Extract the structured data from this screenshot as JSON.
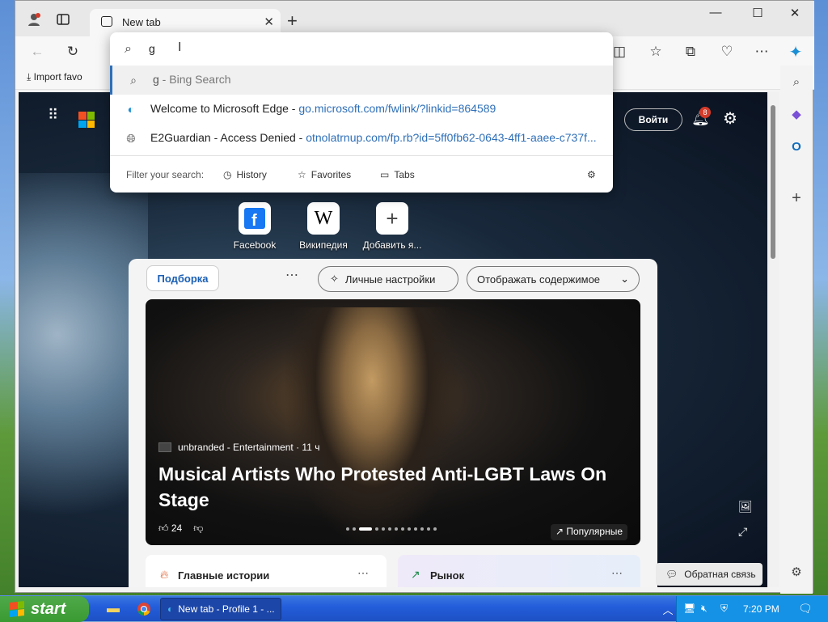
{
  "tabs": [
    {
      "title": "New tab"
    }
  ],
  "favbar": {
    "import_label": "Import favo"
  },
  "omnibox": {
    "value": "g",
    "suggestions": [
      {
        "text": "g",
        "detail": "Bing Search"
      },
      {
        "text": "Welcome to Microsoft Edge",
        "url": "go.microsoft.com/fwlink/?linkid=864589"
      },
      {
        "text": "E2Guardian - Access Denied",
        "url": "otnolatrnup.com/fp.rb?id=5ff0fb62-0643-4ff1-aaee-c737f..."
      }
    ],
    "filter_label": "Filter your search:",
    "filters": [
      "History",
      "Favorites",
      "Tabs"
    ]
  },
  "ntp": {
    "signin_label": "Войти",
    "notifications": "8",
    "feedback_label": "Обратная связь"
  },
  "quick_links": [
    "Facebook",
    "Википедия",
    "Добавить я..."
  ],
  "feed": {
    "tab_active": "Подборка",
    "personalize_label": "Личные настройки",
    "display_label": "Отображать содержимое",
    "hero": {
      "source": "unbranded - Entertainment · 11 ч",
      "title": "Musical Artists Who Protested Anti-LGBT Laws On Stage",
      "likes": "24",
      "badge": "Популярные"
    },
    "cards": [
      "Главные истории",
      "Рынок"
    ]
  },
  "taskbar": {
    "start_label": "start",
    "edge_window": "New tab - Profile 1 - ...",
    "time": "7:20 PM"
  }
}
